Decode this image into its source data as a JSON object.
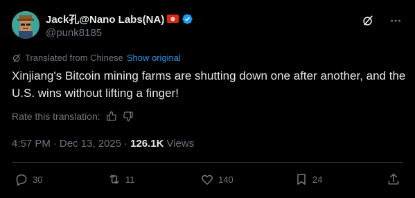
{
  "author": {
    "display_name": "Jack孔@Nano Labs(NA)",
    "handle": "@punk8185"
  },
  "translation": {
    "label": "Translated from Chinese",
    "show_original": "Show original",
    "rate_label": "Rate this translation:"
  },
  "tweet": {
    "text": "Xinjiang's Bitcoin mining farms are shutting down one after another, and the U.S. wins without lifting a finger!",
    "time": "4:57 PM",
    "separator1": "·",
    "date": "Dec 13, 2025",
    "separator2": "·",
    "views_count": "126.1K",
    "views_label": "Views"
  },
  "actions": {
    "replies": "30",
    "reposts": "11",
    "likes": "140",
    "bookmarks": "24"
  },
  "colors": {
    "background": "#000000",
    "primary_text": "#e7e9ea",
    "secondary_text": "#71767b",
    "accent": "#1d9bf0",
    "flag_red": "#de2910"
  },
  "icons": [
    "grok-icon",
    "more-icon",
    "verified-badge-icon",
    "hong-kong-flag-icon",
    "translate-icon",
    "thumbs-up-icon",
    "thumbs-down-icon",
    "reply-icon",
    "repost-icon",
    "like-icon",
    "bookmark-icon",
    "share-icon"
  ]
}
